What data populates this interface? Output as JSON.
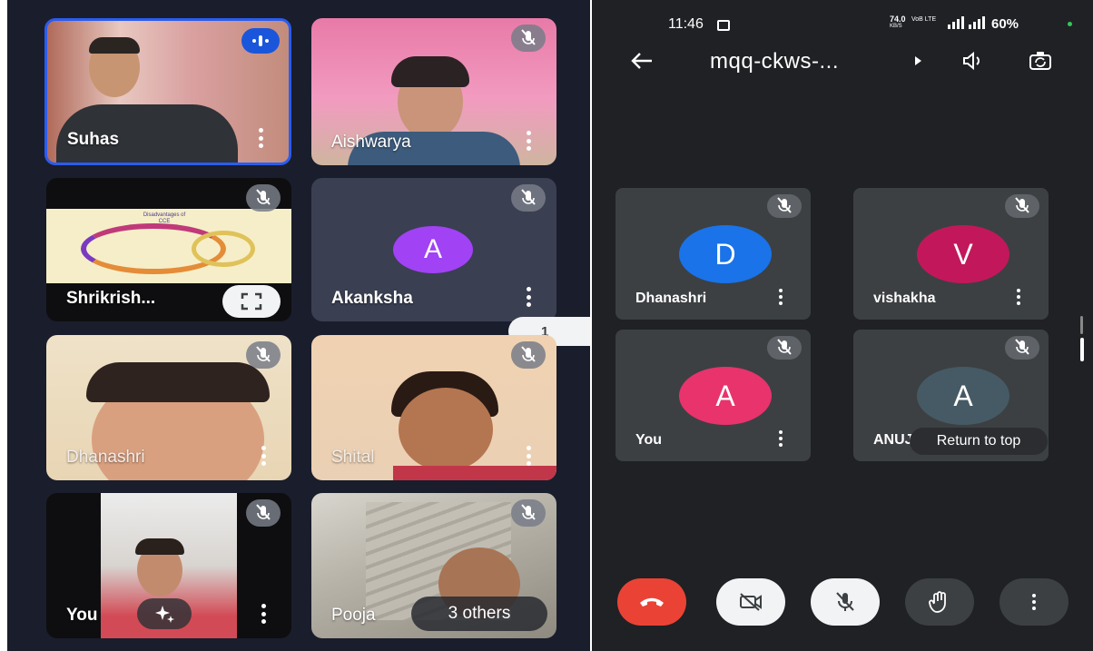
{
  "status_bar": {
    "time": "11:46",
    "net_speed": "74.0",
    "net_unit": "KB/S",
    "net_type": "VoB LTE",
    "battery": "60%"
  },
  "header": {
    "meeting_code": "mqq-ckws-...",
    "back_icon": "arrow-left-icon",
    "speaker_icon": "speaker-icon",
    "switch_camera_icon": "camera-switch-icon"
  },
  "left_grid": {
    "tiles": [
      {
        "name": "Suhas",
        "speaking": true
      },
      {
        "name": "Aishwarya"
      },
      {
        "name": "Shrikrish...",
        "slide_title": "Disadvantages of CCE"
      },
      {
        "name": "Akanksha",
        "avatar_letter": "A"
      },
      {
        "name": "Dhanashri"
      },
      {
        "name": "Shital"
      },
      {
        "name": "You"
      },
      {
        "name": "Pooja"
      }
    ],
    "others_label": "3 others",
    "page_indicator": "1"
  },
  "right_grid": {
    "tiles": [
      {
        "name": "Dhanashri",
        "avatar_letter": "D",
        "color": "#1a73e8"
      },
      {
        "name": "vishakha",
        "avatar_letter": "V",
        "color": "#c2185b"
      },
      {
        "name": "You",
        "avatar_letter": "A",
        "color": "#e8336d"
      },
      {
        "name": "ANUJ",
        "avatar_letter": "A",
        "color": "#455a64"
      }
    ],
    "return_to_top": "Return to top"
  },
  "controls": {
    "end_call_icon": "phone-hangup-icon",
    "camera_off_icon": "video-off-icon",
    "mic_off_icon": "mic-off-icon",
    "raise_hand_icon": "hand-icon",
    "more_icon": "more-vertical-icon"
  },
  "colors": {
    "end_call": "#ea4335",
    "speaking_border": "#2a5cf0"
  }
}
